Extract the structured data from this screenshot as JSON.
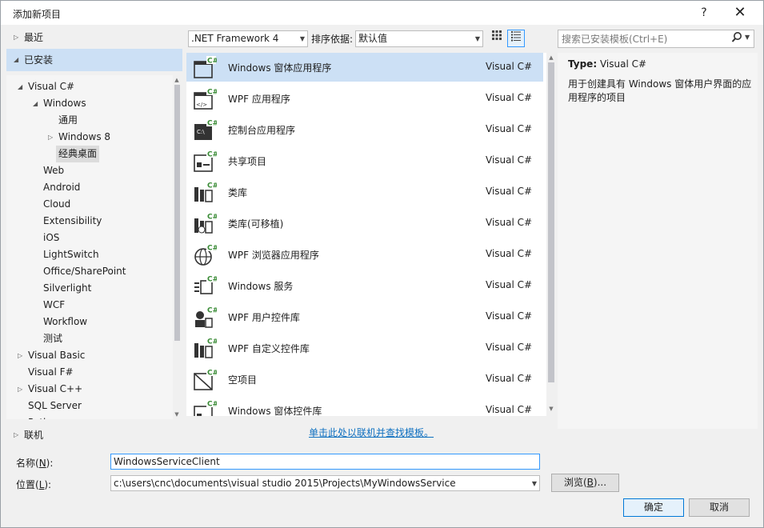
{
  "window": {
    "title": "添加新项目",
    "help_glyph": "?",
    "close_glyph": "✕"
  },
  "left": {
    "recent": "最近",
    "installed": "已安装",
    "online": "联机",
    "tree": [
      {
        "label": "Visual C#",
        "depth": 0,
        "arrow": "◢"
      },
      {
        "label": "Windows",
        "depth": 1,
        "arrow": "◢"
      },
      {
        "label": "通用",
        "depth": 2,
        "arrow": ""
      },
      {
        "label": "Windows 8",
        "depth": 2,
        "arrow": "▷"
      },
      {
        "label": "经典桌面",
        "depth": 2,
        "arrow": "",
        "selected": true
      },
      {
        "label": "Web",
        "depth": 1,
        "arrow": ""
      },
      {
        "label": "Android",
        "depth": 1,
        "arrow": ""
      },
      {
        "label": "Cloud",
        "depth": 1,
        "arrow": ""
      },
      {
        "label": "Extensibility",
        "depth": 1,
        "arrow": ""
      },
      {
        "label": "iOS",
        "depth": 1,
        "arrow": ""
      },
      {
        "label": "LightSwitch",
        "depth": 1,
        "arrow": ""
      },
      {
        "label": "Office/SharePoint",
        "depth": 1,
        "arrow": ""
      },
      {
        "label": "Silverlight",
        "depth": 1,
        "arrow": ""
      },
      {
        "label": "WCF",
        "depth": 1,
        "arrow": ""
      },
      {
        "label": "Workflow",
        "depth": 1,
        "arrow": ""
      },
      {
        "label": "测试",
        "depth": 1,
        "arrow": ""
      },
      {
        "label": "Visual Basic",
        "depth": 0,
        "arrow": "▷"
      },
      {
        "label": "Visual F#",
        "depth": 0,
        "arrow": ""
      },
      {
        "label": "Visual C++",
        "depth": 0,
        "arrow": "▷"
      },
      {
        "label": "SQL Server",
        "depth": 0,
        "arrow": ""
      },
      {
        "label": "Python",
        "depth": 0,
        "arrow": ""
      }
    ]
  },
  "toolbar": {
    "framework": ".NET Framework 4",
    "sort_label": "排序依据:",
    "sort_value": "默认值",
    "search_placeholder": "搜索已安装模板(Ctrl+E)"
  },
  "templates": [
    {
      "name": "Windows 窗体应用程序",
      "lang": "Visual C#",
      "icon": "winforms-app",
      "selected": true
    },
    {
      "name": "WPF 应用程序",
      "lang": "Visual C#",
      "icon": "wpf-app"
    },
    {
      "name": "控制台应用程序",
      "lang": "Visual C#",
      "icon": "console-app"
    },
    {
      "name": "共享项目",
      "lang": "Visual C#",
      "icon": "shared-project"
    },
    {
      "name": "类库",
      "lang": "Visual C#",
      "icon": "class-library"
    },
    {
      "name": "类库(可移植)",
      "lang": "Visual C#",
      "icon": "portable-library"
    },
    {
      "name": "WPF 浏览器应用程序",
      "lang": "Visual C#",
      "icon": "wpf-browser-app"
    },
    {
      "name": "Windows 服务",
      "lang": "Visual C#",
      "icon": "windows-service"
    },
    {
      "name": "WPF 用户控件库",
      "lang": "Visual C#",
      "icon": "wpf-user-control"
    },
    {
      "name": "WPF 自定义控件库",
      "lang": "Visual C#",
      "icon": "wpf-custom-control"
    },
    {
      "name": "空项目",
      "lang": "Visual C#",
      "icon": "empty-project"
    },
    {
      "name": "Windows 窗体控件库",
      "lang": "Visual C#",
      "icon": "winforms-control"
    }
  ],
  "online_link": "单击此处以联机并查找模板。",
  "details": {
    "type_label": "Type:",
    "type_value": "Visual C#",
    "description": "用于创建具有 Windows 窗体用户界面的应用程序的项目"
  },
  "form": {
    "name_label_pre": "名称(",
    "name_label_key": "N",
    "name_label_post": "):",
    "name_value": "WindowsServiceClient",
    "location_label_pre": "位置(",
    "location_label_key": "L",
    "location_label_post": "):",
    "location_value": "c:\\users\\cnc\\documents\\visual studio 2015\\Projects\\MyWindowsService",
    "browse_pre": "浏览(",
    "browse_key": "B",
    "browse_post": ")...",
    "ok": "确定",
    "cancel": "取消"
  },
  "colors": {
    "selection": "#cce0f5",
    "link": "#0e70c0",
    "csharp_badge": "#388a34",
    "focus": "#3399ff"
  }
}
